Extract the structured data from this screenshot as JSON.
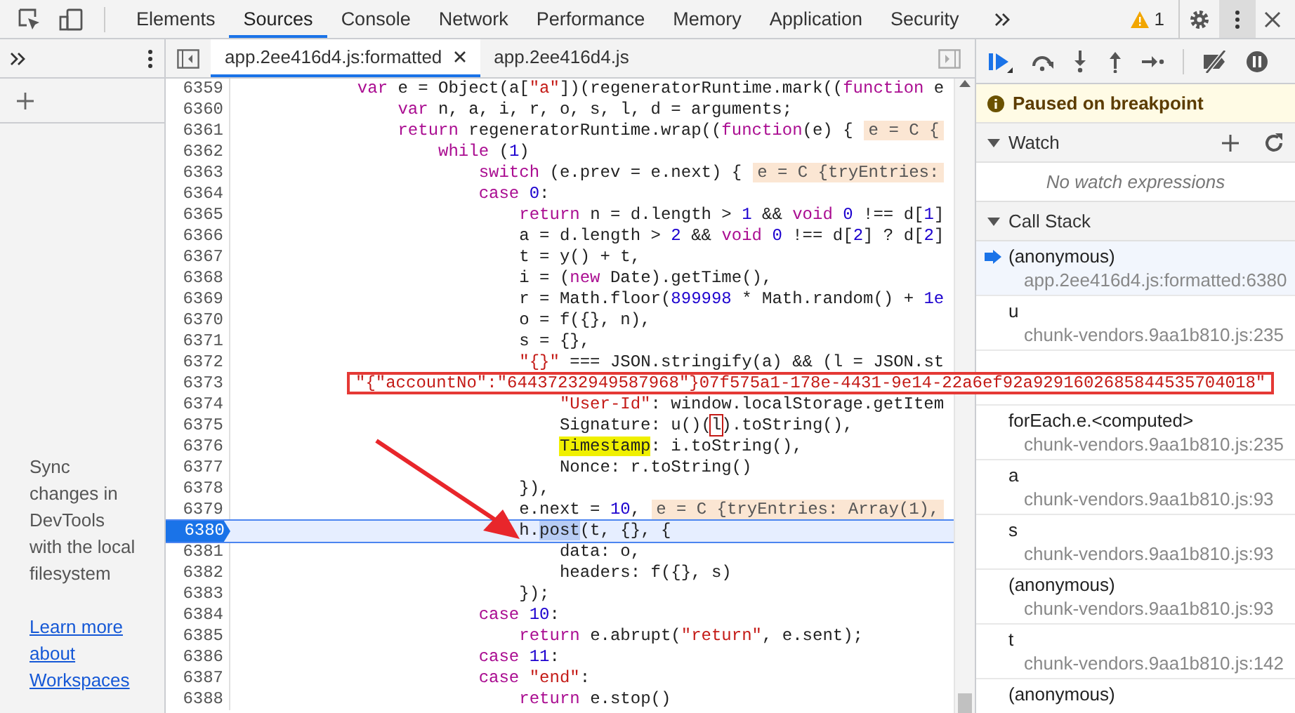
{
  "toolbar": {
    "tabs": [
      {
        "label": "Elements",
        "selected": false
      },
      {
        "label": "Sources",
        "selected": true
      },
      {
        "label": "Console",
        "selected": false
      },
      {
        "label": "Network",
        "selected": false
      },
      {
        "label": "Performance",
        "selected": false
      },
      {
        "label": "Memory",
        "selected": false
      },
      {
        "label": "Application",
        "selected": false
      },
      {
        "label": "Security",
        "selected": false
      }
    ],
    "warnings": "1"
  },
  "navigator": {
    "message": "Sync changes in DevTools with the local filesystem",
    "link": "Learn more about Workspaces"
  },
  "editor": {
    "tabs": [
      {
        "label": "app.2ee416d4.js:formatted",
        "selected": true,
        "closable": true
      },
      {
        "label": "app.2ee416d4.js",
        "selected": false,
        "closable": false
      }
    ],
    "lines": [
      {
        "number": "6359",
        "current": false,
        "tokens": [
          {
            "kind": "keyword",
            "text": "            var"
          },
          {
            "kind": "plain",
            "text": " e = Object(a["
          },
          {
            "kind": "string",
            "text": "\"a\""
          },
          {
            "kind": "plain",
            "text": "])(regeneratorRuntime.mark(("
          },
          {
            "kind": "keyword",
            "text": "function"
          },
          {
            "kind": "plain",
            "text": " e"
          }
        ]
      },
      {
        "number": "6360",
        "current": false,
        "tokens": [
          {
            "kind": "keyword",
            "text": "                var"
          },
          {
            "kind": "plain",
            "text": " n, a, i, r, o, s, l, d = arguments;"
          }
        ]
      },
      {
        "number": "6361",
        "current": false,
        "tokens": [
          {
            "kind": "keyword",
            "text": "                return"
          },
          {
            "kind": "plain",
            "text": " regeneratorRuntime.wrap(("
          },
          {
            "kind": "keyword",
            "text": "function"
          },
          {
            "kind": "plain",
            "text": "(e) {"
          },
          {
            "kind": "hint",
            "text": "e = C {"
          }
        ]
      },
      {
        "number": "6362",
        "current": false,
        "tokens": [
          {
            "kind": "keyword",
            "text": "                    while"
          },
          {
            "kind": "plain",
            "text": " ("
          },
          {
            "kind": "number",
            "text": "1"
          },
          {
            "kind": "plain",
            "text": ")"
          }
        ]
      },
      {
        "number": "6363",
        "current": false,
        "tokens": [
          {
            "kind": "keyword",
            "text": "                        switch"
          },
          {
            "kind": "plain",
            "text": " (e.prev = e.next) {"
          },
          {
            "kind": "hint",
            "text": "e = C {tryEntries:"
          }
        ]
      },
      {
        "number": "6364",
        "current": false,
        "tokens": [
          {
            "kind": "keyword",
            "text": "                        case"
          },
          {
            "kind": "number",
            "text": " 0"
          },
          {
            "kind": "plain",
            "text": ":"
          }
        ]
      },
      {
        "number": "6365",
        "current": false,
        "tokens": [
          {
            "kind": "keyword",
            "text": "                            return"
          },
          {
            "kind": "plain",
            "text": " n = d.length > "
          },
          {
            "kind": "number",
            "text": "1"
          },
          {
            "kind": "plain",
            "text": " && "
          },
          {
            "kind": "keyword",
            "text": "void"
          },
          {
            "kind": "number",
            "text": " 0"
          },
          {
            "kind": "plain",
            "text": " !== d["
          },
          {
            "kind": "number",
            "text": "1"
          },
          {
            "kind": "plain",
            "text": "]"
          }
        ]
      },
      {
        "number": "6366",
        "current": false,
        "tokens": [
          {
            "kind": "plain",
            "text": "                            a = d.length > "
          },
          {
            "kind": "number",
            "text": "2"
          },
          {
            "kind": "plain",
            "text": " && "
          },
          {
            "kind": "keyword",
            "text": "void"
          },
          {
            "kind": "number",
            "text": " 0"
          },
          {
            "kind": "plain",
            "text": " !== d["
          },
          {
            "kind": "number",
            "text": "2"
          },
          {
            "kind": "plain",
            "text": "] ? d["
          },
          {
            "kind": "number",
            "text": "2"
          },
          {
            "kind": "plain",
            "text": "]"
          }
        ]
      },
      {
        "number": "6367",
        "current": false,
        "tokens": [
          {
            "kind": "plain",
            "text": "                            t = y() + t,"
          }
        ]
      },
      {
        "number": "6368",
        "current": false,
        "tokens": [
          {
            "kind": "plain",
            "text": "                            i = ("
          },
          {
            "kind": "keyword",
            "text": "new"
          },
          {
            "kind": "plain",
            "text": " Date).getTime(),"
          }
        ]
      },
      {
        "number": "6369",
        "current": false,
        "tokens": [
          {
            "kind": "plain",
            "text": "                            r = Math.floor("
          },
          {
            "kind": "number",
            "text": "899998"
          },
          {
            "kind": "plain",
            "text": " * Math.random() + "
          },
          {
            "kind": "number",
            "text": "1e"
          }
        ]
      },
      {
        "number": "6370",
        "current": false,
        "tokens": [
          {
            "kind": "plain",
            "text": "                            o = f({}, n),"
          }
        ]
      },
      {
        "number": "6371",
        "current": false,
        "tokens": [
          {
            "kind": "plain",
            "text": "                            s = {},"
          }
        ]
      },
      {
        "number": "6372",
        "current": false,
        "tokens": [
          {
            "kind": "string",
            "text": "                            \"{}\""
          },
          {
            "kind": "plain",
            "text": " === JSON.stringify(a) && (l = JSON.st"
          }
        ]
      },
      {
        "number": "6373",
        "current": false
      },
      {
        "number": "6374",
        "current": false,
        "tokens": [
          {
            "kind": "string",
            "text": "                                \"User-Id\""
          },
          {
            "kind": "plain",
            "text": ": window.localStorage.getItem"
          }
        ]
      },
      {
        "number": "6375",
        "current": false,
        "tokens": [
          {
            "kind": "plain",
            "text": "                                Signature: u()("
          },
          {
            "kind": "boxed",
            "text": "l"
          },
          {
            "kind": "plain",
            "text": ").toString(),"
          }
        ]
      },
      {
        "number": "6376",
        "current": false,
        "tokens": [
          {
            "kind": "marked",
            "text": "                                Timestamp"
          },
          {
            "kind": "plain",
            "text": ": i.toString(),"
          }
        ]
      },
      {
        "number": "6377",
        "current": false,
        "tokens": [
          {
            "kind": "plain",
            "text": "                                Nonce: r.toString()"
          }
        ]
      },
      {
        "number": "6378",
        "current": false,
        "tokens": [
          {
            "kind": "plain",
            "text": "                            }),"
          }
        ]
      },
      {
        "number": "6379",
        "current": false,
        "tokens": [
          {
            "kind": "plain",
            "text": "                            e.next = "
          },
          {
            "kind": "number",
            "text": "10"
          },
          {
            "kind": "plain",
            "text": ","
          },
          {
            "kind": "hint",
            "text": "e = C {tryEntries: Array(1),"
          }
        ]
      },
      {
        "number": "6380",
        "current": true,
        "tokens": [
          {
            "kind": "plain",
            "text": "                            h."
          },
          {
            "kind": "execution",
            "text": "post"
          },
          {
            "kind": "plain",
            "text": "(t, {}, {"
          }
        ]
      },
      {
        "number": "6381",
        "current": false,
        "tokens": [
          {
            "kind": "plain",
            "text": "                                data: o,"
          }
        ]
      },
      {
        "number": "6382",
        "current": false,
        "tokens": [
          {
            "kind": "plain",
            "text": "                                headers: f({}, s)"
          }
        ]
      },
      {
        "number": "6383",
        "current": false,
        "tokens": [
          {
            "kind": "plain",
            "text": "                            });"
          }
        ]
      },
      {
        "number": "6384",
        "current": false,
        "tokens": [
          {
            "kind": "keyword",
            "text": "                        case"
          },
          {
            "kind": "number",
            "text": " 10"
          },
          {
            "kind": "plain",
            "text": ":"
          }
        ]
      },
      {
        "number": "6385",
        "current": false,
        "tokens": [
          {
            "kind": "keyword",
            "text": "                            return"
          },
          {
            "kind": "plain",
            "text": " e.abrupt("
          },
          {
            "kind": "string",
            "text": "\"return\""
          },
          {
            "kind": "plain",
            "text": ", e.sent);"
          }
        ]
      },
      {
        "number": "6386",
        "current": false,
        "tokens": [
          {
            "kind": "keyword",
            "text": "                        case"
          },
          {
            "kind": "number",
            "text": " 11"
          },
          {
            "kind": "plain",
            "text": ":"
          }
        ]
      },
      {
        "number": "6387",
        "current": false,
        "tokens": [
          {
            "kind": "keyword",
            "text": "                        case"
          },
          {
            "kind": "string",
            "text": " \"end\""
          },
          {
            "kind": "plain",
            "text": ":"
          }
        ]
      },
      {
        "number": "6388",
        "current": false,
        "tokens": [
          {
            "kind": "keyword",
            "text": "                            return"
          },
          {
            "kind": "plain",
            "text": " e.stop()"
          }
        ]
      }
    ],
    "tooltip": "\"{\"accountNo\":\"64437232949587968\"}07f575a1-178e-4431-9e14-22a6ef92a9291602685844535704018\""
  },
  "debugger": {
    "banner": "Paused on breakpoint",
    "watch": {
      "title": "Watch",
      "expanded": true,
      "empty": "No watch expressions"
    },
    "call_stack": {
      "title": "Call Stack",
      "expanded": true,
      "frames": [
        {
          "name": "(anonymous)",
          "location": "app.2ee416d4.js:formatted:6380",
          "selected": true
        },
        {
          "name": "u",
          "location": "chunk-vendors.9aa1b810.js:235",
          "selected": false
        },
        {
          "selected": false
        },
        {
          "name": "forEach.e.<computed>",
          "location": "chunk-vendors.9aa1b810.js:235",
          "selected": false
        },
        {
          "name": "a",
          "location": "chunk-vendors.9aa1b810.js:93",
          "selected": false
        },
        {
          "name": "s",
          "location": "chunk-vendors.9aa1b810.js:93",
          "selected": false
        },
        {
          "name": "(anonymous)",
          "location": "chunk-vendors.9aa1b810.js:93",
          "selected": false
        },
        {
          "name": "t",
          "location": "chunk-vendors.9aa1b810.js:142",
          "selected": false
        },
        {
          "name": "(anonymous)",
          "selected": false
        }
      ]
    }
  }
}
